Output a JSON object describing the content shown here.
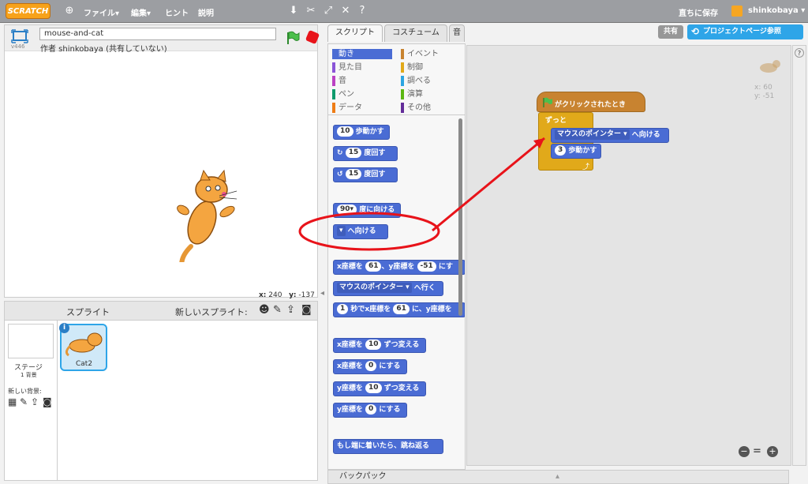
{
  "menu": {
    "logo": "SCRATCH",
    "file": "ファイル▾",
    "edit": "編集▾",
    "hint": "ヒント",
    "about": "説明",
    "save": "直ちに保存",
    "user": "shinkobaya ▾"
  },
  "stage": {
    "version": "v446",
    "project_name": "mouse-and-cat",
    "author": "作者 shinkobaya (共有していない)",
    "x_label": "x:",
    "x_value": "240",
    "y_label": "y:",
    "y_value": "-137"
  },
  "sprites": {
    "title": "スプライト",
    "new_sprite": "新しいスプライト:",
    "stage_label": "ステージ",
    "stage_count": "1 背景",
    "new_bg": "新しい背景:",
    "cat_name": "Cat2"
  },
  "tabs": {
    "script": "スクリプト",
    "costume": "コスチューム",
    "sound": "音"
  },
  "top_buttons": {
    "share": "共有",
    "project_page": "プロジェクトページ参照"
  },
  "categories": [
    {
      "label": "動き",
      "color": "#4a6cd4",
      "active": true
    },
    {
      "label": "イベント",
      "color": "#c88330"
    },
    {
      "label": "見た目",
      "color": "#8a55d7"
    },
    {
      "label": "制御",
      "color": "#e1a91a"
    },
    {
      "label": "音",
      "color": "#bb42c3"
    },
    {
      "label": "調べる",
      "color": "#2ca5e2"
    },
    {
      "label": "ペン",
      "color": "#0e9a6c"
    },
    {
      "label": "演算",
      "color": "#5cb712"
    },
    {
      "label": "データ",
      "color": "#ee7d16"
    },
    {
      "label": "その他",
      "color": "#632d99"
    }
  ],
  "blocks": {
    "move_num": "10",
    "move_label": "歩動かす",
    "turn_num": "15",
    "turn_label": "度回す",
    "turn2_num": "15",
    "turn2_label": "度回す",
    "point_dir": "90▾",
    "point_dir_label": "度に向ける",
    "point_towards_dd": "▾",
    "point_towards_label": "へ向ける",
    "goto_prefix": "x座標を",
    "goto_x": "61",
    "goto_mid": "、y座標を",
    "goto_y": "-51",
    "goto_suffix": "にす",
    "goto_pointer": "マウスのポインター ▾",
    "goto_pointer_label": "へ行く",
    "glide_num": "1",
    "glide_a": "秒でx座標を",
    "glide_x": "61",
    "glide_b": "に、y座標を",
    "change_x_prefix": "x座標を",
    "change_x": "10",
    "change_x_label": "ずつ変える",
    "set_x_prefix": "x座標を",
    "set_x": "0",
    "set_x_label": "にする",
    "change_y_prefix": "y座標を",
    "change_y": "10",
    "change_y_label": "ずつ変える",
    "set_y_prefix": "y座標を",
    "set_y": "0",
    "set_y_label": "にする",
    "bounce": "もし端に着いたら、跳ね返る"
  },
  "script": {
    "hat": "がクリックされたとき",
    "forever": "ずっと",
    "point_pointer": "マウスのポインター ▾",
    "point_label": "へ向ける",
    "move_num": "3",
    "move_label": "歩動かす",
    "sprite_x": "x: 60",
    "sprite_y": "y: -51",
    "zoom_out": "−",
    "zoom_reset": "=",
    "zoom_in": "+",
    "help": "?"
  },
  "backpack": "バックパック",
  "annotation_color": "#e8131a"
}
